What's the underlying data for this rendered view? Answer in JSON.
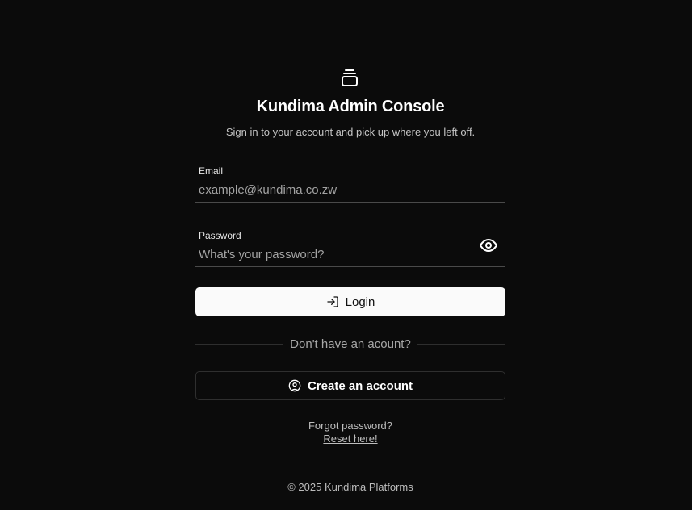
{
  "brand": {
    "logo_icon": "stacked-layers-icon",
    "title": "Kundima Admin Console",
    "subtitle": "Sign in to your account and pick up where you left off."
  },
  "form": {
    "email": {
      "label": "Email",
      "value": "",
      "placeholder": "example@kundima.co.zw"
    },
    "password": {
      "label": "Password",
      "value": "",
      "placeholder": "What's your password?",
      "toggle_icon": "eye-icon"
    },
    "login_button": {
      "label": "Login",
      "icon": "log-in-icon"
    }
  },
  "signup": {
    "divider_text": "Don't have an acount?",
    "create_button": {
      "label": "Create an account",
      "icon": "user-circle-icon"
    }
  },
  "recovery": {
    "prompt": "Forgot password?",
    "link": "Reset here!"
  },
  "footer": {
    "text": "© 2025 Kundima Platforms"
  },
  "colors": {
    "background": "#0b0b0b",
    "primary_button": "#fafafa",
    "text": "#ffffff",
    "muted_text": "#a8a8a8"
  }
}
